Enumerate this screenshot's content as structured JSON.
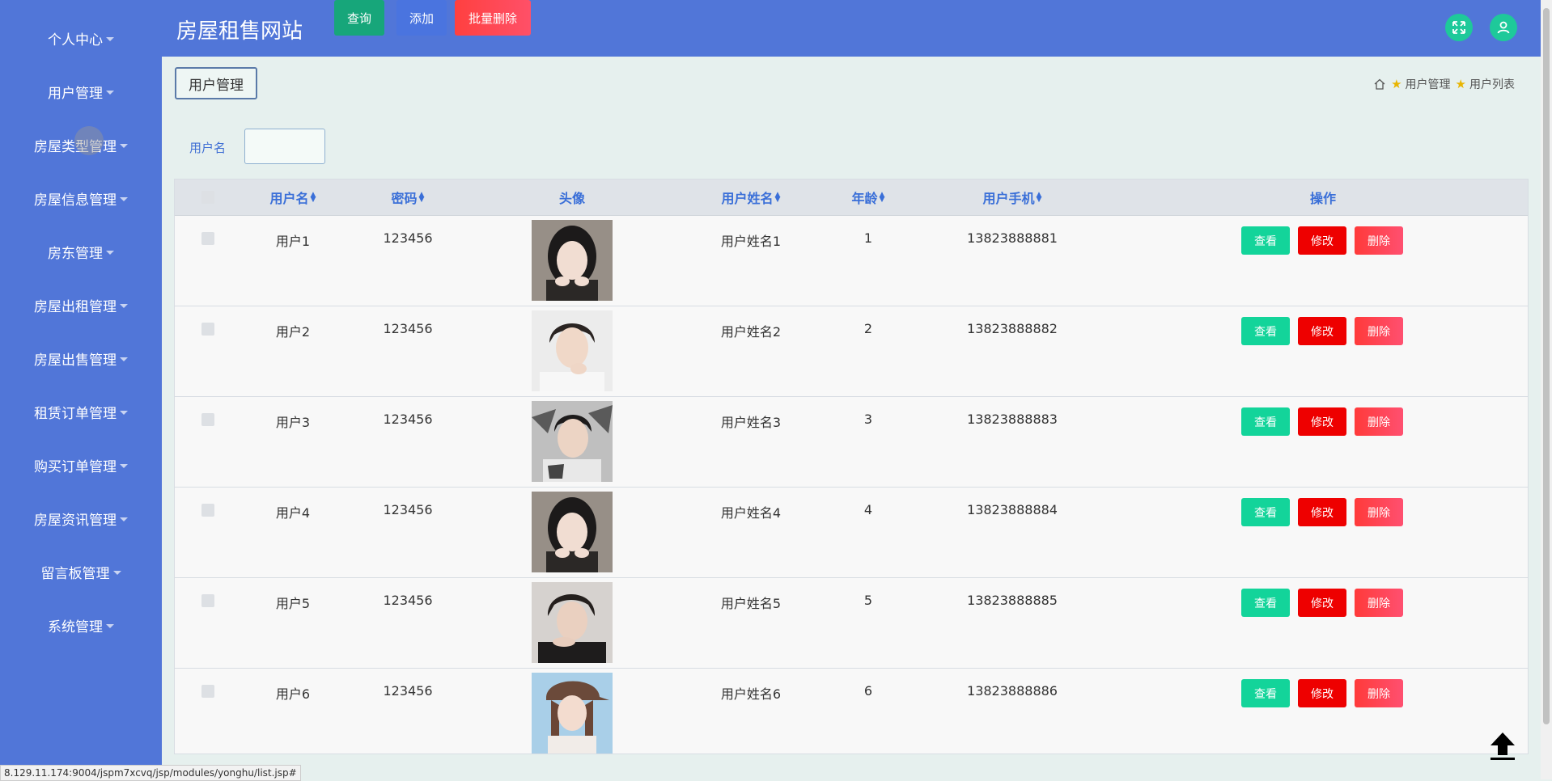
{
  "app": {
    "site_title": "房屋租售网站"
  },
  "sidebar": {
    "items": [
      {
        "label": "个人中心"
      },
      {
        "label": "用户管理"
      },
      {
        "label": "房屋类型管理"
      },
      {
        "label": "房屋信息管理"
      },
      {
        "label": "房东管理"
      },
      {
        "label": "房屋出租管理"
      },
      {
        "label": "房屋出售管理"
      },
      {
        "label": "租赁订单管理"
      },
      {
        "label": "购买订单管理"
      },
      {
        "label": "房屋资讯管理"
      },
      {
        "label": "留言板管理"
      },
      {
        "label": "系统管理"
      }
    ]
  },
  "header": {
    "fullscreen_icon": "fullscreen-icon",
    "user_icon": "user-icon",
    "accent_color": "#1ec99a"
  },
  "page": {
    "tab_label": "用户管理",
    "breadcrumb": {
      "level1": "用户管理",
      "level2": "用户列表"
    }
  },
  "search": {
    "label": "用户名",
    "value": "",
    "query_button": "查询",
    "add_button": "添加",
    "batch_delete_button": "批量删除"
  },
  "table": {
    "columns": {
      "username": "用户名",
      "password": "密码",
      "avatar": "头像",
      "name": "用户姓名",
      "age": "年龄",
      "phone": "用户手机",
      "actions": "操作"
    },
    "action_labels": {
      "view": "查看",
      "edit": "修改",
      "delete": "删除"
    },
    "rows": [
      {
        "username": "用户1",
        "password": "123456",
        "name": "用户姓名1",
        "age": "1",
        "phone": "13823888881"
      },
      {
        "username": "用户2",
        "password": "123456",
        "name": "用户姓名2",
        "age": "2",
        "phone": "13823888882"
      },
      {
        "username": "用户3",
        "password": "123456",
        "name": "用户姓名3",
        "age": "3",
        "phone": "13823888883"
      },
      {
        "username": "用户4",
        "password": "123456",
        "name": "用户姓名4",
        "age": "4",
        "phone": "13823888884"
      },
      {
        "username": "用户5",
        "password": "123456",
        "name": "用户姓名5",
        "age": "5",
        "phone": "13823888885"
      },
      {
        "username": "用户6",
        "password": "123456",
        "name": "用户姓名6",
        "age": "6",
        "phone": "13823888886"
      }
    ]
  },
  "status_bar": {
    "url": "8.129.11.174:9004/jspm7xcvq/jsp/modules/yonghu/list.jsp#"
  }
}
